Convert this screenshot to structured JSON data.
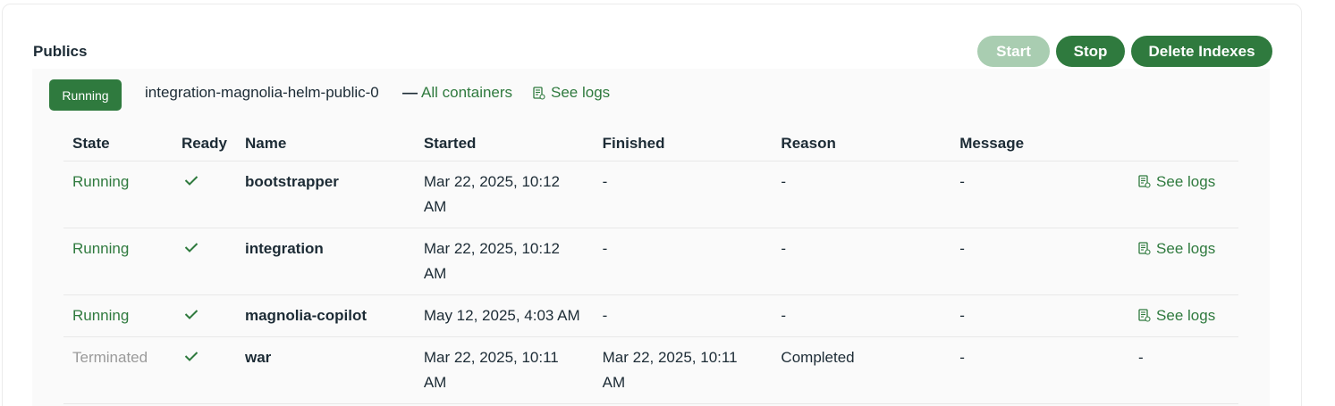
{
  "section": {
    "title": "Publics"
  },
  "actions": {
    "start_label": "Start",
    "stop_label": "Stop",
    "delete_label": "Delete Indexes"
  },
  "pod": {
    "status": "Running",
    "name": "integration-magnolia-helm-public-0",
    "all_containers_label": "All containers",
    "see_logs_label": "See logs"
  },
  "table": {
    "headers": [
      "State",
      "Ready",
      "Name",
      "Started",
      "Finished",
      "Reason",
      "Message"
    ],
    "rows": [
      {
        "state": "Running",
        "ready": true,
        "name": "bootstrapper",
        "started": "Mar 22, 2025, 10:12 AM",
        "finished": "-",
        "reason": "-",
        "message": "-",
        "logs": "See logs"
      },
      {
        "state": "Running",
        "ready": true,
        "name": "integration",
        "started": "Mar 22, 2025, 10:12 AM",
        "finished": "-",
        "reason": "-",
        "message": "-",
        "logs": "See logs"
      },
      {
        "state": "Running",
        "ready": true,
        "name": "magnolia-copilot",
        "started": "May 12, 2025, 4:03 AM",
        "finished": "-",
        "reason": "-",
        "message": "-",
        "logs": "See logs"
      },
      {
        "state": "Terminated",
        "ready": true,
        "name": "war",
        "started": "Mar 22, 2025, 10:11 AM",
        "finished": "Mar 22, 2025, 10:11 AM",
        "reason": "Completed",
        "message": "-",
        "logs": "-"
      }
    ]
  },
  "colors": {
    "accent": "#2f7a3e",
    "accent_disabled": "#a9cdb1",
    "terminated": "#9a9a9a",
    "text": "#1c2b35"
  },
  "icons": {
    "logs": "document-logs-icon",
    "ready": "check-icon"
  }
}
